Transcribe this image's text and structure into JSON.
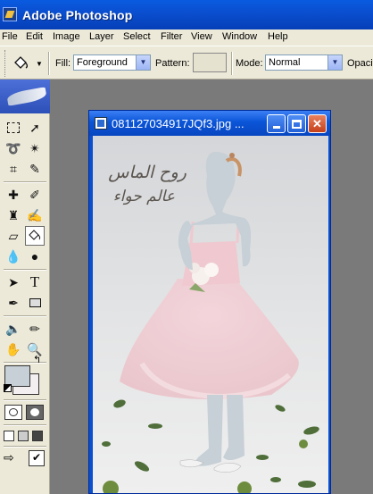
{
  "app": {
    "title": "Adobe Photoshop"
  },
  "menu": [
    "File",
    "Edit",
    "Image",
    "Layer",
    "Select",
    "Filter",
    "View",
    "Window",
    "Help"
  ],
  "options": {
    "fill_label": "Fill:",
    "fill_value": "Foreground",
    "pattern_label": "Pattern:",
    "mode_label": "Mode:",
    "mode_value": "Normal",
    "opacity_label": "Opacit"
  },
  "document": {
    "title": "081127034917JQf3.jpg ...",
    "watermark_line1": "روح الماس",
    "watermark_line2": "عالم حواء"
  },
  "colors": {
    "foreground": "#c7d0d6",
    "background": "#f3eeef",
    "accent_blue": "#0a4fd0"
  }
}
